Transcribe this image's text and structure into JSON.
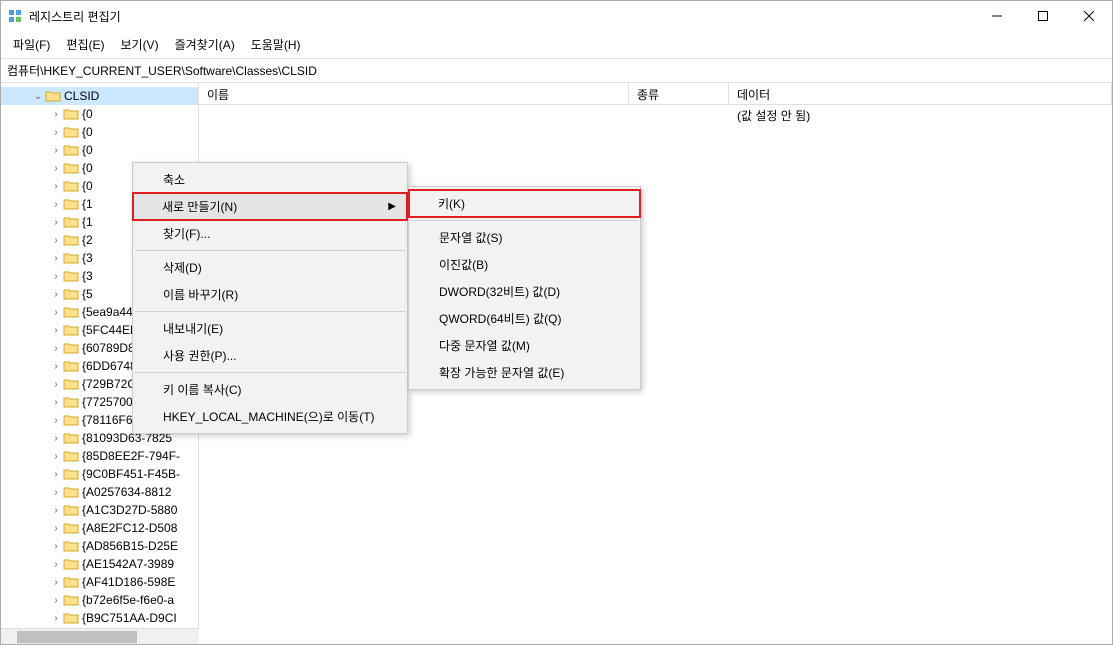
{
  "window": {
    "title": "레지스트리 편집기"
  },
  "menubar": {
    "file": "파일(F)",
    "edit": "편집(E)",
    "view": "보기(V)",
    "favorites": "즐겨찾기(A)",
    "help": "도움말(H)"
  },
  "address": "컴퓨터\\HKEY_CURRENT_USER\\Software\\Classes\\CLSID",
  "tree": {
    "selected": "CLSID",
    "truncated": [
      "{0",
      "{0",
      "{0",
      "{0",
      "{0",
      "{1",
      "{1",
      "{2",
      "{3",
      "{3",
      "{5"
    ],
    "items": [
      "{5ea9a442-5352-",
      "{5FC44EBC-3A1F",
      "{60789D87-9C30",
      "{6DD6748E-7DA",
      "{729B72CD-B72E",
      "{77257004-6F25-",
      "{78116F60-2C60",
      "{81093D63-7825",
      "{85D8EE2F-794F-",
      "{9C0BF451-F45B-",
      "{A0257634-8812",
      "{A1C3D27D-5880",
      "{A8E2FC12-D508",
      "{AD856B15-D25E",
      "{AE1542A7-3989",
      "{AF41D186-598E",
      "{b72e6f5e-f6e0-a",
      "{B9C751AA-D9CI"
    ]
  },
  "columns": {
    "name": "이름",
    "type": "종류",
    "data": "데이터"
  },
  "listvalue": {
    "name": "",
    "data": "(값 설정 안 됨)"
  },
  "contextmenu": {
    "collapse": "축소",
    "new": "새로 만들기(N)",
    "find": "찾기(F)...",
    "delete": "삭제(D)",
    "rename": "이름 바꾸기(R)",
    "export": "내보내기(E)",
    "permissions": "사용 권한(P)...",
    "copykeyname": "키 이름 복사(C)",
    "goto": "HKEY_LOCAL_MACHINE(으)로 이동(T)"
  },
  "submenu": {
    "key": "키(K)",
    "string": "문자열 값(S)",
    "binary": "이진값(B)",
    "dword": "DWORD(32비트) 값(D)",
    "qword": "QWORD(64비트) 값(Q)",
    "multistring": "다중 문자열 값(M)",
    "expandstring": "확장 가능한 문자열 값(E)"
  }
}
